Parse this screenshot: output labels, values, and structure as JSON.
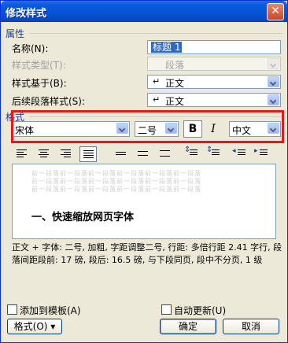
{
  "window": {
    "title": "修改样式",
    "close_glyph": "✕"
  },
  "properties": {
    "group_label": "属性",
    "name_label": "名称(N):",
    "name_value": "标题 1",
    "style_type_label": "样式类型(T):",
    "style_type_value": "段落",
    "based_on_label": "样式基于(B):",
    "based_on_value": "正文",
    "next_style_label": "后续段落样式(S):",
    "next_style_value": "正文"
  },
  "format": {
    "group_label": "格式",
    "font": "宋体",
    "size": "二号",
    "bold_label": "B",
    "italic_label": "I",
    "script": "中文"
  },
  "preview": {
    "prev_text": "前一段落前一段落前一段落前一段落前一段落前一段落",
    "heading": "一、快速缩放网页字体"
  },
  "description": "正文 + 字体: 二号, 加粗, 字距调整二号, 行距: 多倍行距 2.41 字行, 段落间距段前: 17 磅, 段后: 16.5 磅, 与下段同页, 段中不分页, 1 级",
  "footer": {
    "add_to_template": "添加到模板(A)",
    "auto_update": "自动更新(U)",
    "format_button": "格式(O) ▾",
    "ok": "确定",
    "cancel": "取消"
  },
  "colors": {
    "title_bar": "#0852d2",
    "highlight": "#e21a1a",
    "group_label": "#1a3ea8"
  }
}
